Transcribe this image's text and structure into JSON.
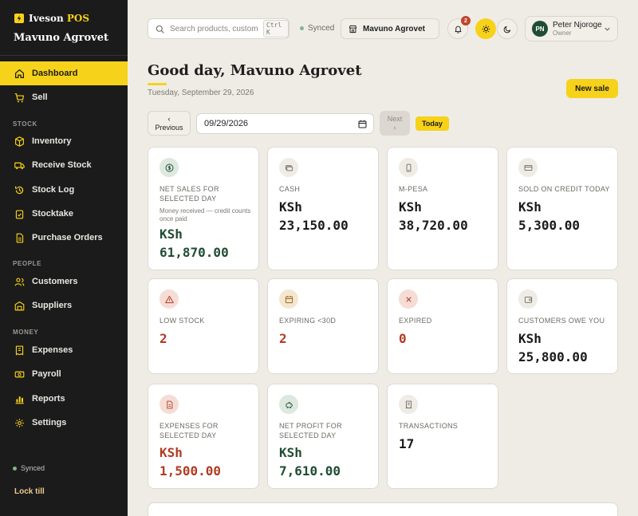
{
  "sidebar": {
    "brand": "Iveson",
    "brand_suffix": "POS",
    "store": "Mavuno Agrovet",
    "sections": {
      "stock": "STOCK",
      "people": "PEOPLE",
      "money": "MONEY"
    },
    "items": {
      "dashboard": "Dashboard",
      "sell": "Sell",
      "inventory": "Inventory",
      "receive_stock": "Receive Stock",
      "stock_log": "Stock Log",
      "stocktake": "Stocktake",
      "purchase_orders": "Purchase Orders",
      "customers": "Customers",
      "suppliers": "Suppliers",
      "expenses": "Expenses",
      "payroll": "Payroll",
      "reports": "Reports",
      "settings": "Settings"
    },
    "synced": "Synced",
    "lock_till": "Lock till"
  },
  "topbar": {
    "search_placeholder": "Search products, customers",
    "search_shortcut": "Ctrl K",
    "sync_status": "Synced",
    "store_selector": "Mavuno Agrovet",
    "notification_count": "2",
    "user_initials": "PN",
    "user_name": "Peter Njoroge",
    "user_role": "Owner"
  },
  "header": {
    "greeting": "Good day, Mavuno Agrovet",
    "date": "Tuesday, September 29, 2026",
    "new_sale": "New sale"
  },
  "datenav": {
    "prev_arrow": "‹",
    "prev_label": "Previous",
    "date_value": "09/29/2026",
    "next_label": "Next",
    "next_arrow": "›",
    "today": "Today"
  },
  "cards": {
    "net_sales": {
      "label": "NET SALES FOR SELECTED DAY",
      "sub": "Money received — credit counts once paid",
      "currency": "KSh",
      "amount": "61,870.00"
    },
    "cash": {
      "label": "CASH",
      "currency": "KSh",
      "amount": "23,150.00"
    },
    "mpesa": {
      "label": "M-PESA",
      "currency": "KSh",
      "amount": "38,720.00"
    },
    "credit": {
      "label": "SOLD ON CREDIT TODAY",
      "currency": "KSh",
      "amount": "5,300.00"
    },
    "low_stock": {
      "label": "LOW STOCK",
      "value": "2"
    },
    "expiring": {
      "label": "EXPIRING <30D",
      "value": "2"
    },
    "expired": {
      "label": "EXPIRED",
      "value": "0"
    },
    "owed": {
      "label": "CUSTOMERS OWE YOU",
      "currency": "KSh",
      "amount": "25,800.00"
    },
    "expenses": {
      "label": "EXPENSES FOR SELECTED DAY",
      "currency": "KSh",
      "amount": "1,500.00"
    },
    "profit": {
      "label": "NET PROFIT FOR SELECTED DAY",
      "currency": "KSh",
      "amount": "7,610.00"
    },
    "transactions": {
      "label": "TRANSACTIONS",
      "value": "17"
    }
  },
  "colors": {
    "accent": "#f7d21a",
    "sidebar_bg": "#1b1b1b",
    "positive": "#204d34",
    "negative": "#b23b22",
    "page_bg": "#efece6"
  }
}
